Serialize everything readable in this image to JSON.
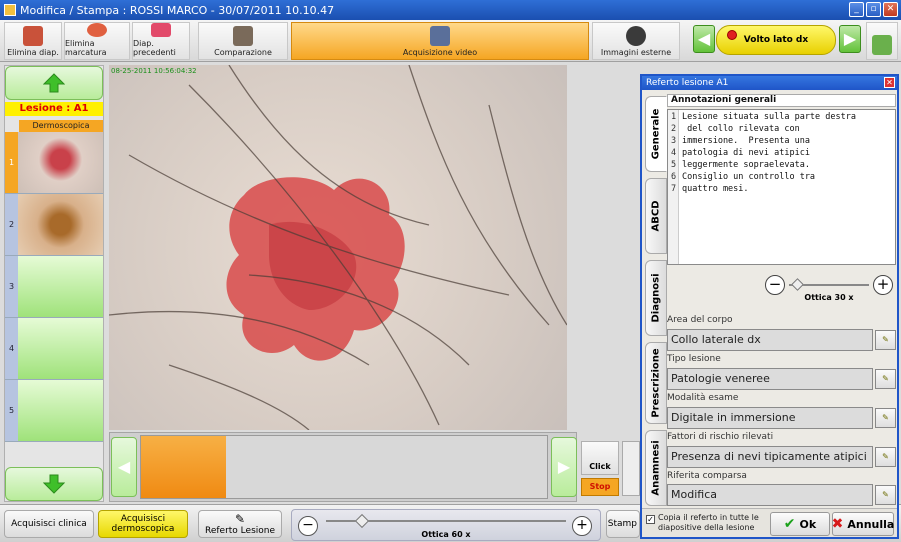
{
  "window": {
    "title": "Modifica / Stampa : ROSSI MARCO  -  30/07/2011 10.10.47"
  },
  "toolbar": {
    "elimina_diap": "Elimina diap.",
    "elimina_marcatura": "Elimina marcatura",
    "diap_precedenti": "Diap. precedenti",
    "comparazione": "Comparazione",
    "acquisizione_video": "Acquisizione video",
    "immagini_esterne": "Immagini esterne",
    "volto_lato": "Volto lato dx"
  },
  "left": {
    "lesione": "Lesione : A1",
    "category": "Dermoscopica",
    "slots": [
      "1",
      "2",
      "3",
      "4",
      "5"
    ]
  },
  "main": {
    "overlay_text": "08-25-2011  10:56:04:32"
  },
  "capture": {
    "click": "Click",
    "stop": "Stop"
  },
  "bottom": {
    "acquisisci_clinica": "Acquisisci clinica",
    "acquisisci_dermoscopica": "Acquisisci dermoscopica",
    "referto_lesione": "Referto Lesione",
    "ottica": "Ottica 60 x",
    "stampa": "Stamp"
  },
  "dialog": {
    "title": "Referto lesione A1",
    "tabs": [
      "Generale",
      "ABCD",
      "Diagnosi",
      "Prescrizione",
      "Anamnesi"
    ],
    "annotazioni_label": "Annotazioni generali",
    "notes": [
      "Lesione situata sulla parte destra",
      " del collo rilevata con",
      "immersione.  Presenta una",
      "patologia di nevi atipici",
      "leggermente sopraelevata.",
      "Consiglio un controllo tra",
      "quattro mesi."
    ],
    "ottica": "Ottica 30 x",
    "fields": [
      {
        "label": "Area del corpo",
        "value": "Collo laterale dx"
      },
      {
        "label": "Tipo lesione",
        "value": "Patologie veneree"
      },
      {
        "label": "Modalità esame",
        "value": "Digitale in immersione"
      },
      {
        "label": "Fattori di rischio rilevati",
        "value": "Presenza di nevi tipicamente atipici"
      },
      {
        "label": "Riferita comparsa",
        "value": "Modifica"
      }
    ],
    "copia_label": "Copia il referto in tutte le diapositive della lesione",
    "copia_checked": true,
    "ok": "Ok",
    "annulla": "Annulla"
  },
  "colors": {
    "accent_orange": "#f5a623",
    "selected_yellow": "#fff000",
    "titlebar_blue": "#1f55c8"
  }
}
